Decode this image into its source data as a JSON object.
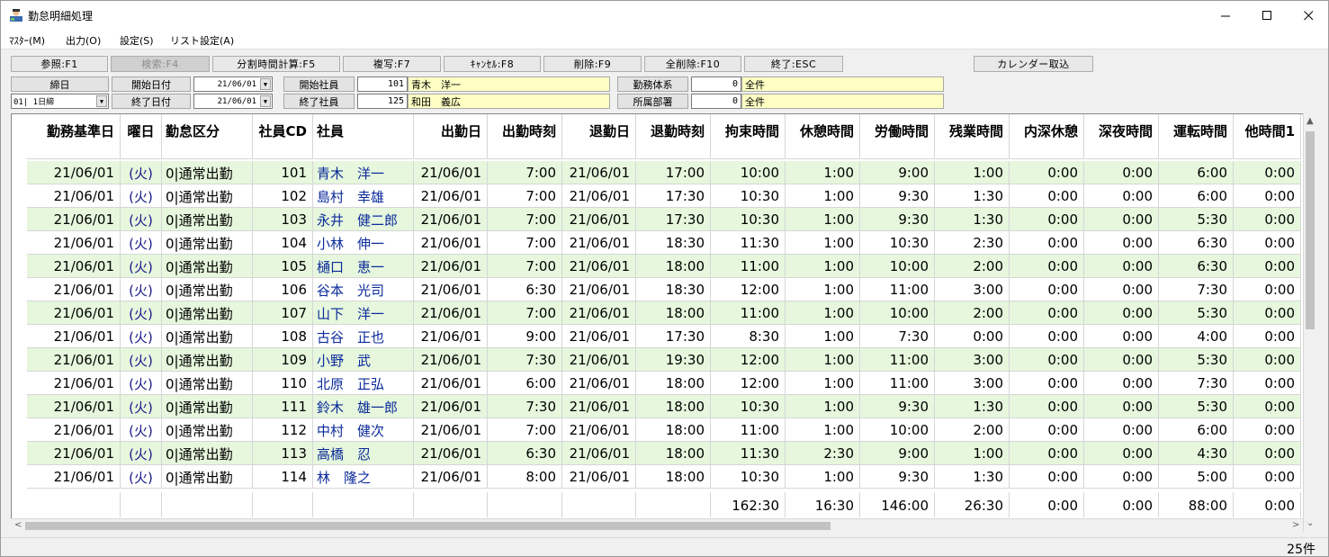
{
  "window": {
    "title": "勤怠明細処理"
  },
  "menu": [
    "ﾏｽﾀｰ(M)",
    "出力(O)",
    "設定(S)",
    "リスト設定(A)"
  ],
  "toolbar": {
    "ref": "参照:F1",
    "search": "検索:F4",
    "split": "分割時間計算:F5",
    "copy": "複写:F7",
    "cancel": "ｷｬﾝｾﾙ:F8",
    "delete": "削除:F9",
    "delete_all": "全削除:F10",
    "exit": "終了:ESC",
    "calendar": "カレンダー取込"
  },
  "criteria": {
    "closing_label": "締日",
    "closing_value": "01| 1日締",
    "start_date_label": "開始日付",
    "start_date": "21/06/01",
    "end_date_label": "終了日付",
    "end_date": "21/06/01",
    "start_emp_label": "開始社員",
    "start_emp_no": "101",
    "start_emp_name": "青木　洋一",
    "end_emp_label": "終了社員",
    "end_emp_no": "125",
    "end_emp_name": "和田　義広",
    "system_label": "勤務体系",
    "system_no": "0",
    "system_name": "全件",
    "dept_label": "所属部署",
    "dept_no": "0",
    "dept_name": "全件"
  },
  "grid": {
    "headers": [
      "勤務基準日",
      "曜日",
      "勤怠区分",
      "社員CD",
      "社員",
      "出勤日",
      "出勤時刻",
      "退勤日",
      "退勤時刻",
      "拘束時間",
      "休憩時間",
      "労働時間",
      "残業時間",
      "内深休憩",
      "深夜時間",
      "運転時間",
      "他時間1"
    ],
    "rows": [
      [
        "21/06/01",
        "(火)",
        "0|通常出勤",
        "101",
        "青木　洋一",
        "21/06/01",
        "7:00",
        "21/06/01",
        "17:00",
        "10:00",
        "1:00",
        "9:00",
        "1:00",
        "0:00",
        "0:00",
        "6:00",
        "0:00"
      ],
      [
        "21/06/01",
        "(火)",
        "0|通常出勤",
        "102",
        "島村　幸雄",
        "21/06/01",
        "7:00",
        "21/06/01",
        "17:30",
        "10:30",
        "1:00",
        "9:30",
        "1:30",
        "0:00",
        "0:00",
        "6:00",
        "0:00"
      ],
      [
        "21/06/01",
        "(火)",
        "0|通常出勤",
        "103",
        "永井　健二郎",
        "21/06/01",
        "7:00",
        "21/06/01",
        "17:30",
        "10:30",
        "1:00",
        "9:30",
        "1:30",
        "0:00",
        "0:00",
        "5:30",
        "0:00"
      ],
      [
        "21/06/01",
        "(火)",
        "0|通常出勤",
        "104",
        "小林　伸一",
        "21/06/01",
        "7:00",
        "21/06/01",
        "18:30",
        "11:30",
        "1:00",
        "10:30",
        "2:30",
        "0:00",
        "0:00",
        "6:30",
        "0:00"
      ],
      [
        "21/06/01",
        "(火)",
        "0|通常出勤",
        "105",
        "樋口　恵一",
        "21/06/01",
        "7:00",
        "21/06/01",
        "18:00",
        "11:00",
        "1:00",
        "10:00",
        "2:00",
        "0:00",
        "0:00",
        "6:30",
        "0:00"
      ],
      [
        "21/06/01",
        "(火)",
        "0|通常出勤",
        "106",
        "谷本　光司",
        "21/06/01",
        "6:30",
        "21/06/01",
        "18:30",
        "12:00",
        "1:00",
        "11:00",
        "3:00",
        "0:00",
        "0:00",
        "7:30",
        "0:00"
      ],
      [
        "21/06/01",
        "(火)",
        "0|通常出勤",
        "107",
        "山下　洋一",
        "21/06/01",
        "7:00",
        "21/06/01",
        "18:00",
        "11:00",
        "1:00",
        "10:00",
        "2:00",
        "0:00",
        "0:00",
        "5:30",
        "0:00"
      ],
      [
        "21/06/01",
        "(火)",
        "0|通常出勤",
        "108",
        "古谷　正也",
        "21/06/01",
        "9:00",
        "21/06/01",
        "17:30",
        "8:30",
        "1:00",
        "7:30",
        "0:00",
        "0:00",
        "0:00",
        "4:00",
        "0:00"
      ],
      [
        "21/06/01",
        "(火)",
        "0|通常出勤",
        "109",
        "小野　武",
        "21/06/01",
        "7:30",
        "21/06/01",
        "19:30",
        "12:00",
        "1:00",
        "11:00",
        "3:00",
        "0:00",
        "0:00",
        "5:30",
        "0:00"
      ],
      [
        "21/06/01",
        "(火)",
        "0|通常出勤",
        "110",
        "北原　正弘",
        "21/06/01",
        "6:00",
        "21/06/01",
        "18:00",
        "12:00",
        "1:00",
        "11:00",
        "3:00",
        "0:00",
        "0:00",
        "7:30",
        "0:00"
      ],
      [
        "21/06/01",
        "(火)",
        "0|通常出勤",
        "111",
        "鈴木　雄一郎",
        "21/06/01",
        "7:30",
        "21/06/01",
        "18:00",
        "10:30",
        "1:00",
        "9:30",
        "1:30",
        "0:00",
        "0:00",
        "5:30",
        "0:00"
      ],
      [
        "21/06/01",
        "(火)",
        "0|通常出勤",
        "112",
        "中村　健次",
        "21/06/01",
        "7:00",
        "21/06/01",
        "18:00",
        "11:00",
        "1:00",
        "10:00",
        "2:00",
        "0:00",
        "0:00",
        "6:00",
        "0:00"
      ],
      [
        "21/06/01",
        "(火)",
        "0|通常出勤",
        "113",
        "高橋　忍",
        "21/06/01",
        "6:30",
        "21/06/01",
        "18:00",
        "11:30",
        "2:30",
        "9:00",
        "1:00",
        "0:00",
        "0:00",
        "4:30",
        "0:00"
      ],
      [
        "21/06/01",
        "(火)",
        "0|通常出勤",
        "114",
        "林　隆之",
        "21/06/01",
        "8:00",
        "21/06/01",
        "18:00",
        "10:30",
        "1:00",
        "9:30",
        "1:30",
        "0:00",
        "0:00",
        "5:00",
        "0:00"
      ]
    ],
    "totals": [
      "",
      "",
      "",
      "",
      "",
      "",
      "",
      "",
      "",
      "162:30",
      "16:30",
      "146:00",
      "26:30",
      "0:00",
      "0:00",
      "88:00",
      "0:00"
    ]
  },
  "status": {
    "count": "25件"
  }
}
